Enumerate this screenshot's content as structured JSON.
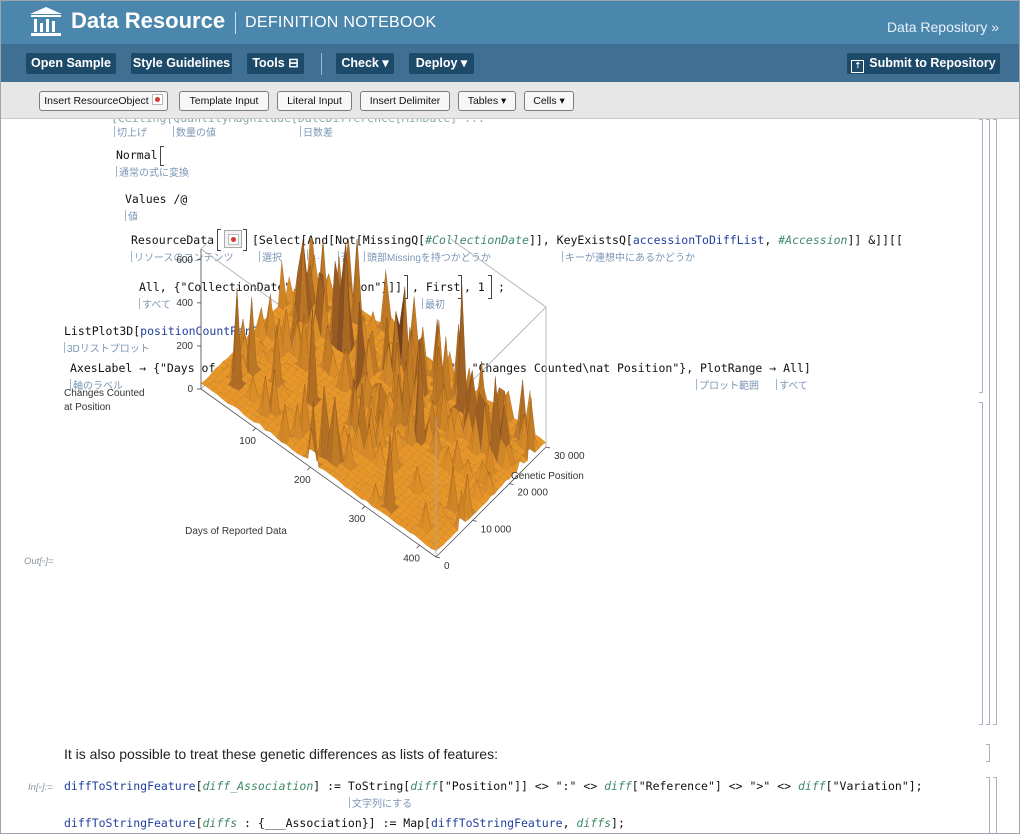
{
  "header": {
    "brand": "Data Resource",
    "subtitle": "DEFINITION NOTEBOOK",
    "repo_link": "Data Repository »"
  },
  "toolbar": {
    "open_sample": "Open Sample",
    "style_guidelines": "Style Guidelines",
    "tools": "Tools ⊟",
    "check": "Check ▾",
    "deploy": "Deploy ▾",
    "submit": "Submit to Repository"
  },
  "palette": {
    "insert_resource": "Insert ResourceObject",
    "template_input": "Template Input",
    "literal_input": "Literal Input",
    "insert_delimiter": "Insert Delimiter",
    "tables": "Tables ▾",
    "cells": "Cells ▾"
  },
  "code": {
    "normal": "Normal",
    "values": "Values /@",
    "resourcedata": "ResourceData",
    "select_a": "[Select[And[Not[MissingQ[",
    "select_b": "#CollectionDate",
    "select_c": "]], KeyExistsQ[",
    "select_d": "accessionToDiffList",
    "select_e": ", ",
    "select_f": "#Accession",
    "select_g": "]] &]][[",
    "all_line": "All, {\"CollectionDate\", \"Accession\"}]]",
    "first": ", First",
    "one": ", 1",
    "semi": ";",
    "listplot": "ListPlot3D[",
    "listplot_arg": "positionCountPerCollectionDay",
    "listplot_end": ",",
    "axeslabel": "AxesLabel → {\"Days of Reported Data\", \"Genetic Position\", \"Changes Counted\\nat Position\"}, PlotRange → All]",
    "diff1_a": "diffToStringFeature",
    "diff1_b": "[",
    "diff1_c": "diff_Association",
    "diff1_d": "] := ToString[",
    "diff1_e": "diff",
    "diff1_f": "[\"Position\"]] <> \":\" <> ",
    "diff1_g": "diff",
    "diff1_h": "[\"Reference\"] <> \">\" <> ",
    "diff1_i": "diff",
    "diff1_j": "[\"Variation\"];",
    "diff2_a": "diffToStringFeature",
    "diff2_b": "[",
    "diff2_c": "diffs",
    "diff2_d": " : {___Association}] := Map[",
    "diff2_e": "diffToStringFeature",
    "diff2_f": ", ",
    "diff2_g": "diffs",
    "diff2_h": "];"
  },
  "annotations": {
    "ceil": "切上げ",
    "qty": "数量の値",
    "days": "日数差",
    "normal": "通常の式に変換",
    "values": "値",
    "resource": "リソースのコンテンツ",
    "select": "選択",
    "and": "…",
    "not": "否",
    "missing": "頭部Missingを持つかどうか",
    "keyexists": "キーが連想中にあるかどうか",
    "all": "すべて",
    "first": "最初",
    "listplot": "3Dリストプロット",
    "axeslabel": "軸のラベル",
    "plotrange": "プロット範囲",
    "all2": "すべて",
    "tostring": "文字列にする"
  },
  "labels": {
    "out": "Out[▫]=",
    "in": "In[▫]:="
  },
  "text": {
    "paragraph": "It is also possible to treat these genetic differences as lists of features:"
  },
  "chart_data": {
    "type": "surface",
    "xlabel": "Days of Reported Data",
    "ylabel": "Genetic Position",
    "zlabel_line1": "Changes Counted",
    "zlabel_line2": "at Position",
    "x_ticks": [
      "100",
      "200",
      "300",
      "400"
    ],
    "y_ticks": [
      "0",
      "10000",
      "20000",
      "30000"
    ],
    "y_tick_labels": [
      "0",
      "10 000",
      "20 000",
      "30 000"
    ],
    "z_ticks": [
      "0",
      "200",
      "400",
      "600"
    ],
    "xlim": [
      0,
      430
    ],
    "ylim": [
      0,
      30000
    ],
    "zlim": [
      0,
      650
    ],
    "color": "#f5a028"
  }
}
